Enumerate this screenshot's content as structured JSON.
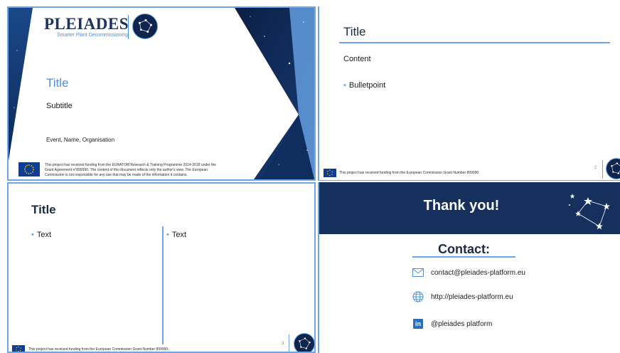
{
  "title_slide": {
    "logo_text": "PLEIADES",
    "logo_subtitle": "Smarter Plant Decommissioning",
    "title": "Title",
    "subtitle": "Subtitle",
    "event": "Event, Name, Organisation",
    "funding_text": "This project has received funding from the EURATOM Research & Training Programme 2014-2018 under the Grant Agreement n°899990. The content of this document reflects only the author's view. The European Commission is not responsible for any use that may be made of the information it contains."
  },
  "content_slide": {
    "title": "Title",
    "content": "Content",
    "bullet": "Bulletpoint",
    "footer": "This project has received funding from the European Commission Grant Number 899990.",
    "page_number": "2"
  },
  "two_column_slide": {
    "title": "Title",
    "left_text": "Text",
    "right_text": "Text",
    "footer": "This project has received funding from the European Commission Grant Number 899990.",
    "page_number": "3"
  },
  "thank_you_slide": {
    "heading": "Thank you!",
    "contact_heading": "Contact:",
    "email": "contact@pleiades-platform.eu",
    "website": "http://pleiades-platform.eu",
    "linkedin": "@pleiades platform",
    "linkedin_icon_label": "in"
  },
  "colors": {
    "navy": "#15305c",
    "accent_blue": "#4c8fdc",
    "light_blue": "#6aa6e8",
    "eu_blue": "#0e3d91",
    "eu_yellow": "#ffcc00"
  },
  "icons": [
    "constellation-logo-icon",
    "eu-flag-icon",
    "mail-icon",
    "globe-icon",
    "linkedin-icon"
  ]
}
